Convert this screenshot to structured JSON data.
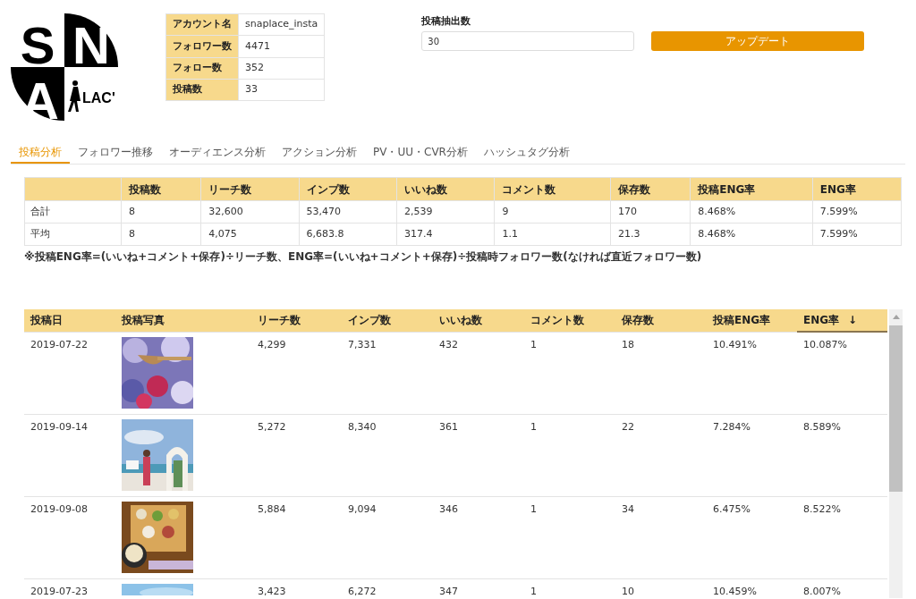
{
  "logo": {
    "letters": [
      "S",
      "N",
      "A"
    ],
    "tail": "LAC'"
  },
  "account": [
    {
      "label": "アカウント名",
      "value": "snaplace_insta"
    },
    {
      "label": "フォロワー数",
      "value": "4471"
    },
    {
      "label": "フォロー数",
      "value": "352"
    },
    {
      "label": "投稿数",
      "value": "33"
    }
  ],
  "extract": {
    "label": "投稿抽出数",
    "value": "30",
    "button": "アップデート"
  },
  "tabs": [
    {
      "label": "投稿分析",
      "selected": true
    },
    {
      "label": "フォロワー推移",
      "selected": false
    },
    {
      "label": "オーディエンス分析",
      "selected": false
    },
    {
      "label": "アクション分析",
      "selected": false
    },
    {
      "label": "PV・UU・CVR分析",
      "selected": false
    },
    {
      "label": "ハッシュタグ分析",
      "selected": false
    }
  ],
  "summary": {
    "columns": [
      "投稿数",
      "リーチ数",
      "インプ数",
      "いいね数",
      "コメント数",
      "保存数",
      "投稿ENG率",
      "ENG率"
    ],
    "rows": [
      {
        "label": "合計",
        "cells": [
          "8",
          "32,600",
          "53,470",
          "2,539",
          "9",
          "170",
          "8.468%",
          "7.599%"
        ]
      },
      {
        "label": "平均",
        "cells": [
          "8",
          "4,075",
          "6,683.8",
          "317.4",
          "1.1",
          "21.3",
          "8.468%",
          "7.599%"
        ]
      }
    ],
    "note": "※投稿ENG率=(いいね+コメント+保存)÷リーチ数、ENG率=(いいね+コメント+保存)÷投稿時フォロワー数(なければ直近フォロワー数)"
  },
  "posts": {
    "columns": [
      {
        "label": "投稿日",
        "sorted": false
      },
      {
        "label": "投稿写真",
        "sorted": false
      },
      {
        "label": "リーチ数",
        "sorted": false
      },
      {
        "label": "インプ数",
        "sorted": false
      },
      {
        "label": "いいね数",
        "sorted": false
      },
      {
        "label": "コメント数",
        "sorted": false
      },
      {
        "label": "保存数",
        "sorted": false
      },
      {
        "label": "投稿ENG率",
        "sorted": false
      },
      {
        "label": "ENG率",
        "sorted": true
      }
    ],
    "sort_icon": "↓",
    "rows": [
      {
        "cells": [
          "2019-07-22",
          {
            "kind": "picture"
          },
          "4,299",
          "7,331",
          "432",
          "1",
          "18",
          "10.491%",
          "10.087%"
        ]
      },
      {
        "cells": [
          "2019-09-14",
          {
            "kind": "picture"
          },
          "5,272",
          "8,340",
          "361",
          "1",
          "22",
          "7.284%",
          "8.589%"
        ]
      },
      {
        "cells": [
          "2019-09-08",
          {
            "kind": "picture"
          },
          "5,884",
          "9,094",
          "346",
          "1",
          "34",
          "6.475%",
          "8.522%"
        ]
      },
      {
        "cells": [
          "2019-07-23",
          {
            "kind": "picture"
          },
          "3,423",
          "6,272",
          "347",
          "1",
          "10",
          "10.459%",
          "8.007%"
        ]
      }
    ]
  }
}
